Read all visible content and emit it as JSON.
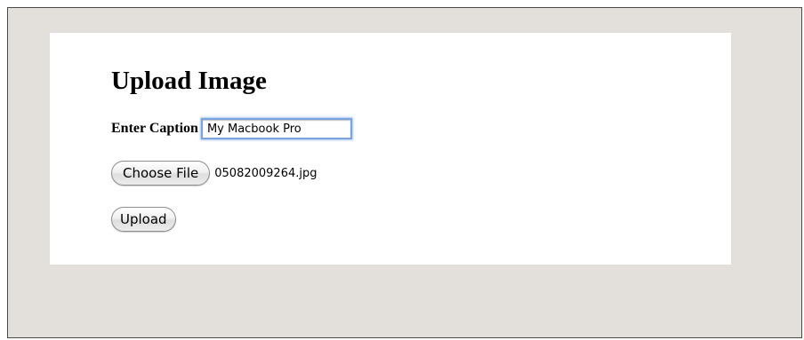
{
  "page": {
    "title": "Upload Image"
  },
  "form": {
    "caption_label": "Enter Caption",
    "caption_value": "My Macbook Pro",
    "choose_file_label": "Choose File",
    "selected_file": "05082009264.jpg",
    "upload_label": "Upload"
  },
  "colors": {
    "page_background": "#e3dfda",
    "card_background": "#ffffff",
    "focus_ring": "#7aa3e0"
  }
}
